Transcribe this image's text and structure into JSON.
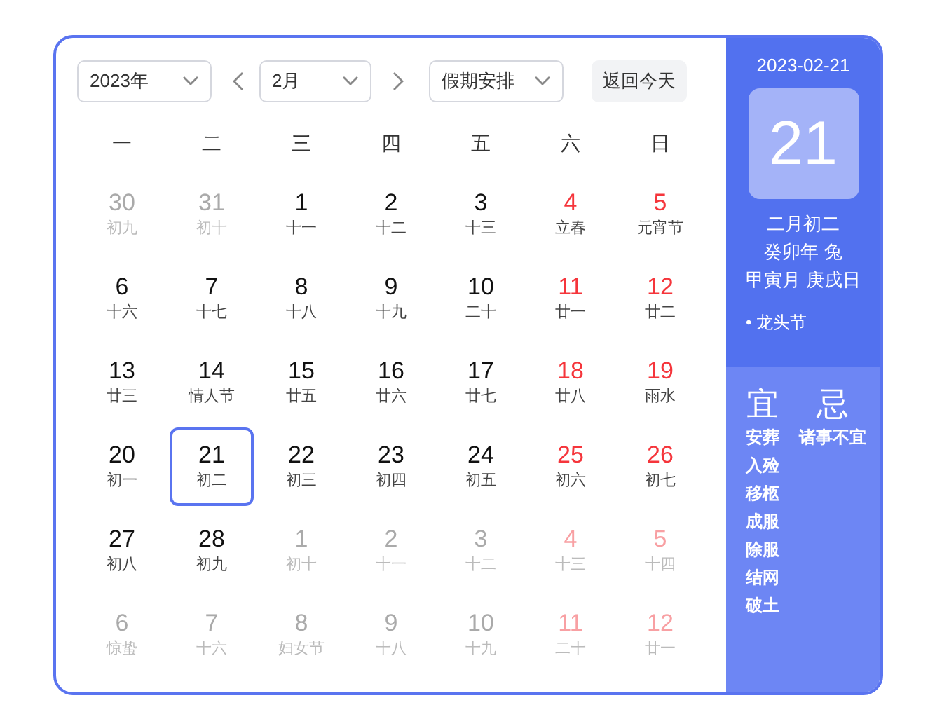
{
  "toolbar": {
    "year": "2023年",
    "month": "2月",
    "holiday": "假期安排",
    "today_button": "返回今天"
  },
  "weekdays": [
    "一",
    "二",
    "三",
    "四",
    "五",
    "六",
    "日"
  ],
  "weeks": [
    [
      {
        "day": "30",
        "lunar": "初九",
        "weekend": false,
        "other_month": true,
        "selected": false
      },
      {
        "day": "31",
        "lunar": "初十",
        "weekend": false,
        "other_month": true,
        "selected": false
      },
      {
        "day": "1",
        "lunar": "十一",
        "weekend": false,
        "other_month": false,
        "selected": false
      },
      {
        "day": "2",
        "lunar": "十二",
        "weekend": false,
        "other_month": false,
        "selected": false
      },
      {
        "day": "3",
        "lunar": "十三",
        "weekend": false,
        "other_month": false,
        "selected": false
      },
      {
        "day": "4",
        "lunar": "立春",
        "weekend": true,
        "other_month": false,
        "selected": false
      },
      {
        "day": "5",
        "lunar": "元宵节",
        "weekend": true,
        "other_month": false,
        "selected": false
      }
    ],
    [
      {
        "day": "6",
        "lunar": "十六",
        "weekend": false,
        "other_month": false,
        "selected": false
      },
      {
        "day": "7",
        "lunar": "十七",
        "weekend": false,
        "other_month": false,
        "selected": false
      },
      {
        "day": "8",
        "lunar": "十八",
        "weekend": false,
        "other_month": false,
        "selected": false
      },
      {
        "day": "9",
        "lunar": "十九",
        "weekend": false,
        "other_month": false,
        "selected": false
      },
      {
        "day": "10",
        "lunar": "二十",
        "weekend": false,
        "other_month": false,
        "selected": false
      },
      {
        "day": "11",
        "lunar": "廿一",
        "weekend": true,
        "other_month": false,
        "selected": false
      },
      {
        "day": "12",
        "lunar": "廿二",
        "weekend": true,
        "other_month": false,
        "selected": false
      }
    ],
    [
      {
        "day": "13",
        "lunar": "廿三",
        "weekend": false,
        "other_month": false,
        "selected": false
      },
      {
        "day": "14",
        "lunar": "情人节",
        "weekend": false,
        "other_month": false,
        "selected": false
      },
      {
        "day": "15",
        "lunar": "廿五",
        "weekend": false,
        "other_month": false,
        "selected": false
      },
      {
        "day": "16",
        "lunar": "廿六",
        "weekend": false,
        "other_month": false,
        "selected": false
      },
      {
        "day": "17",
        "lunar": "廿七",
        "weekend": false,
        "other_month": false,
        "selected": false
      },
      {
        "day": "18",
        "lunar": "廿八",
        "weekend": true,
        "other_month": false,
        "selected": false
      },
      {
        "day": "19",
        "lunar": "雨水",
        "weekend": true,
        "other_month": false,
        "selected": false
      }
    ],
    [
      {
        "day": "20",
        "lunar": "初一",
        "weekend": false,
        "other_month": false,
        "selected": false
      },
      {
        "day": "21",
        "lunar": "初二",
        "weekend": false,
        "other_month": false,
        "selected": true
      },
      {
        "day": "22",
        "lunar": "初三",
        "weekend": false,
        "other_month": false,
        "selected": false
      },
      {
        "day": "23",
        "lunar": "初四",
        "weekend": false,
        "other_month": false,
        "selected": false
      },
      {
        "day": "24",
        "lunar": "初五",
        "weekend": false,
        "other_month": false,
        "selected": false
      },
      {
        "day": "25",
        "lunar": "初六",
        "weekend": true,
        "other_month": false,
        "selected": false
      },
      {
        "day": "26",
        "lunar": "初七",
        "weekend": true,
        "other_month": false,
        "selected": false
      }
    ],
    [
      {
        "day": "27",
        "lunar": "初八",
        "weekend": false,
        "other_month": false,
        "selected": false
      },
      {
        "day": "28",
        "lunar": "初九",
        "weekend": false,
        "other_month": false,
        "selected": false
      },
      {
        "day": "1",
        "lunar": "初十",
        "weekend": false,
        "other_month": true,
        "selected": false
      },
      {
        "day": "2",
        "lunar": "十一",
        "weekend": false,
        "other_month": true,
        "selected": false
      },
      {
        "day": "3",
        "lunar": "十二",
        "weekend": false,
        "other_month": true,
        "selected": false
      },
      {
        "day": "4",
        "lunar": "十三",
        "weekend": true,
        "other_month": true,
        "selected": false
      },
      {
        "day": "5",
        "lunar": "十四",
        "weekend": true,
        "other_month": true,
        "selected": false
      }
    ],
    [
      {
        "day": "6",
        "lunar": "惊蛰",
        "weekend": false,
        "other_month": true,
        "selected": false
      },
      {
        "day": "7",
        "lunar": "十六",
        "weekend": false,
        "other_month": true,
        "selected": false
      },
      {
        "day": "8",
        "lunar": "妇女节",
        "weekend": false,
        "other_month": true,
        "selected": false
      },
      {
        "day": "9",
        "lunar": "十八",
        "weekend": false,
        "other_month": true,
        "selected": false
      },
      {
        "day": "10",
        "lunar": "十九",
        "weekend": false,
        "other_month": true,
        "selected": false
      },
      {
        "day": "11",
        "lunar": "二十",
        "weekend": true,
        "other_month": true,
        "selected": false
      },
      {
        "day": "12",
        "lunar": "廿一",
        "weekend": true,
        "other_month": true,
        "selected": false
      }
    ]
  ],
  "side_panel": {
    "date": "2023-02-21",
    "day": "21",
    "lunar_lines": [
      "二月初二",
      "癸卯年 兔",
      "甲寅月 庚戌日"
    ],
    "festivals": [
      "• 龙头节"
    ],
    "suitable": {
      "title": "宜",
      "items": [
        "安葬",
        "入殓",
        "移柩",
        "成服",
        "除服",
        "结网",
        "破土"
      ]
    },
    "avoid": {
      "title": "忌",
      "items": [
        "诸事不宜"
      ]
    }
  }
}
